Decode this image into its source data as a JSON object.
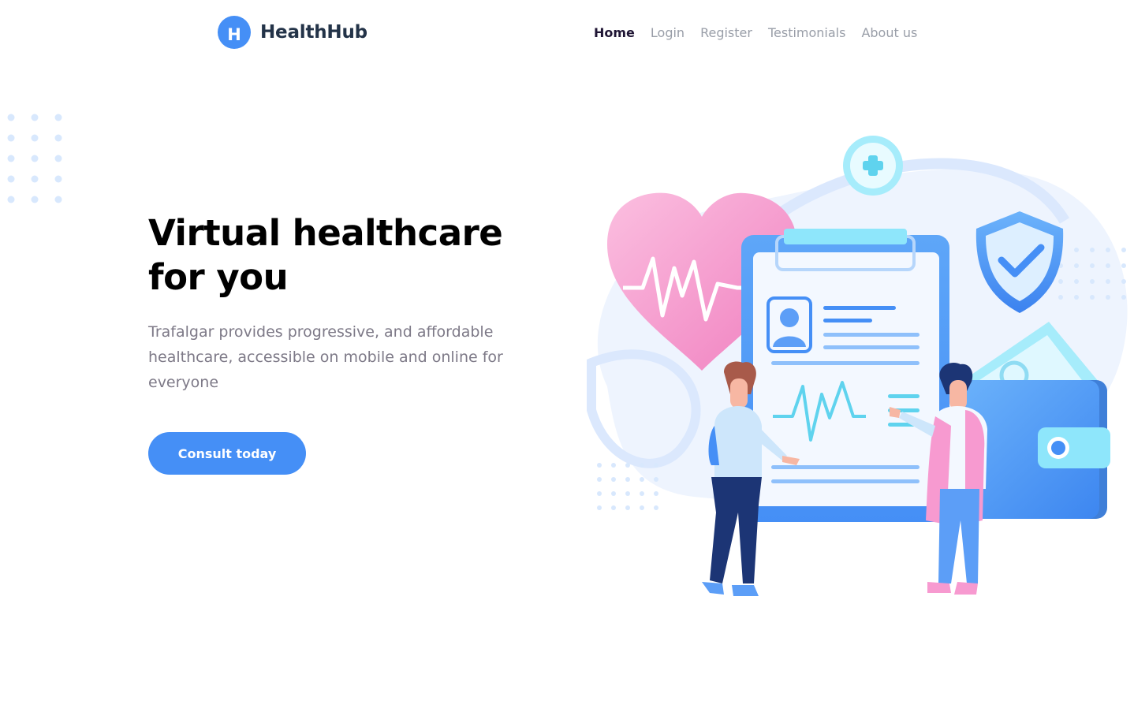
{
  "brand": {
    "initial": "H",
    "name": "HealthHub",
    "accent": "#458ff6"
  },
  "nav": {
    "items": [
      {
        "label": "Home",
        "active": true
      },
      {
        "label": "Login",
        "active": false
      },
      {
        "label": "Register",
        "active": false
      },
      {
        "label": "Testimonials",
        "active": false
      },
      {
        "label": "About us",
        "active": false
      }
    ]
  },
  "hero": {
    "title_line1": "Virtual healthcare",
    "title_line2": "for you",
    "subtitle": "Trafalgar provides progressive, and affordable healthcare, accessible on mobile and online for everyone",
    "cta_label": "Consult today"
  },
  "illustration": {
    "icons": [
      "heart-icon",
      "plus-icon",
      "shield-check-icon",
      "clipboard-icon",
      "wallet-icon",
      "doctor-figure",
      "patient-figure"
    ]
  }
}
